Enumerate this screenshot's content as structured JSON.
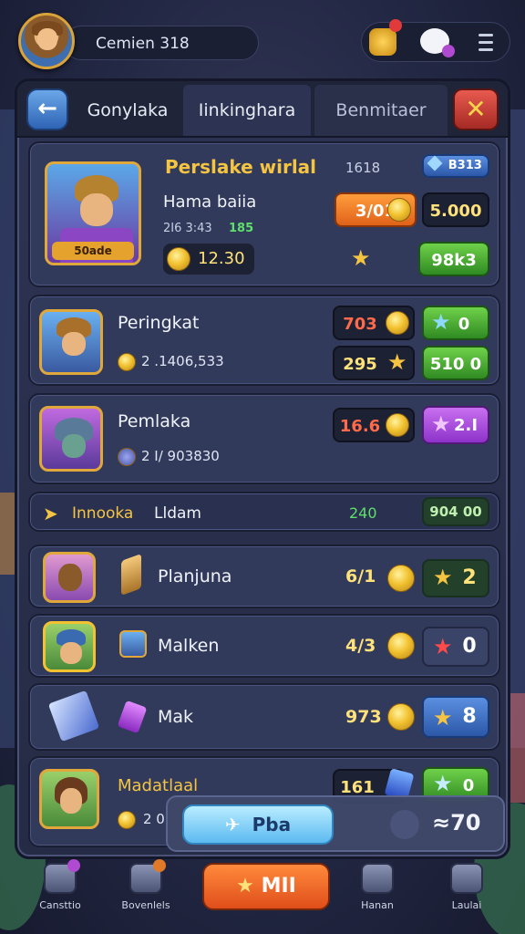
{
  "player": {
    "name": "Cemien 318"
  },
  "header": {
    "menu_icon": "menu-icon"
  },
  "tabs": [
    {
      "label": "Gonylaka",
      "active": false
    },
    {
      "label": "Iinkinghara",
      "active": true
    },
    {
      "label": "Benmitaer",
      "active": false
    }
  ],
  "featured": {
    "title": "Perslake wirlal",
    "subtitle": "Hama baiia",
    "stats": "2I6 3:43",
    "stats_green": "185",
    "portrait_label": "50ade",
    "coin_value": "12.30",
    "top_right_text": "1618",
    "badge_label": "B313",
    "price_orange": "3/01",
    "price_dark": "5.000",
    "green_value": "98k3"
  },
  "rows": [
    {
      "name": "Peringkat",
      "sub": "2 .1406,533",
      "val1": "703",
      "val2": "0",
      "val3": "295",
      "val4": "510 0"
    },
    {
      "name": "Pemlaka",
      "sub": "2 I/ 903830",
      "val1": "16.6",
      "val2": "2.I"
    }
  ],
  "section": {
    "title": "Innooka",
    "title2": "Lldam",
    "green_text": "240",
    "value": "904 00"
  },
  "list": [
    {
      "name": "Planjuna",
      "value": "6/1",
      "badge": "2"
    },
    {
      "name": "Malken",
      "value": "4/3",
      "badge": "0"
    },
    {
      "name": "Mak",
      "value": "973",
      "badge": "8"
    },
    {
      "name": "Madatlaal",
      "value": "161",
      "badge": "0",
      "sub": "2 0"
    }
  ],
  "popup": {
    "button_label": "Pba",
    "value": "≈70"
  },
  "nav": [
    {
      "label": "Cansttio"
    },
    {
      "label": "Bovenlels"
    },
    {
      "label": "MII"
    },
    {
      "label": "Hanan"
    },
    {
      "label": "Laulai"
    }
  ],
  "colors": {
    "accent_green": "#4fb83a",
    "accent_orange": "#f07a28",
    "gold": "#f2c230",
    "panel": "#2d3352"
  }
}
